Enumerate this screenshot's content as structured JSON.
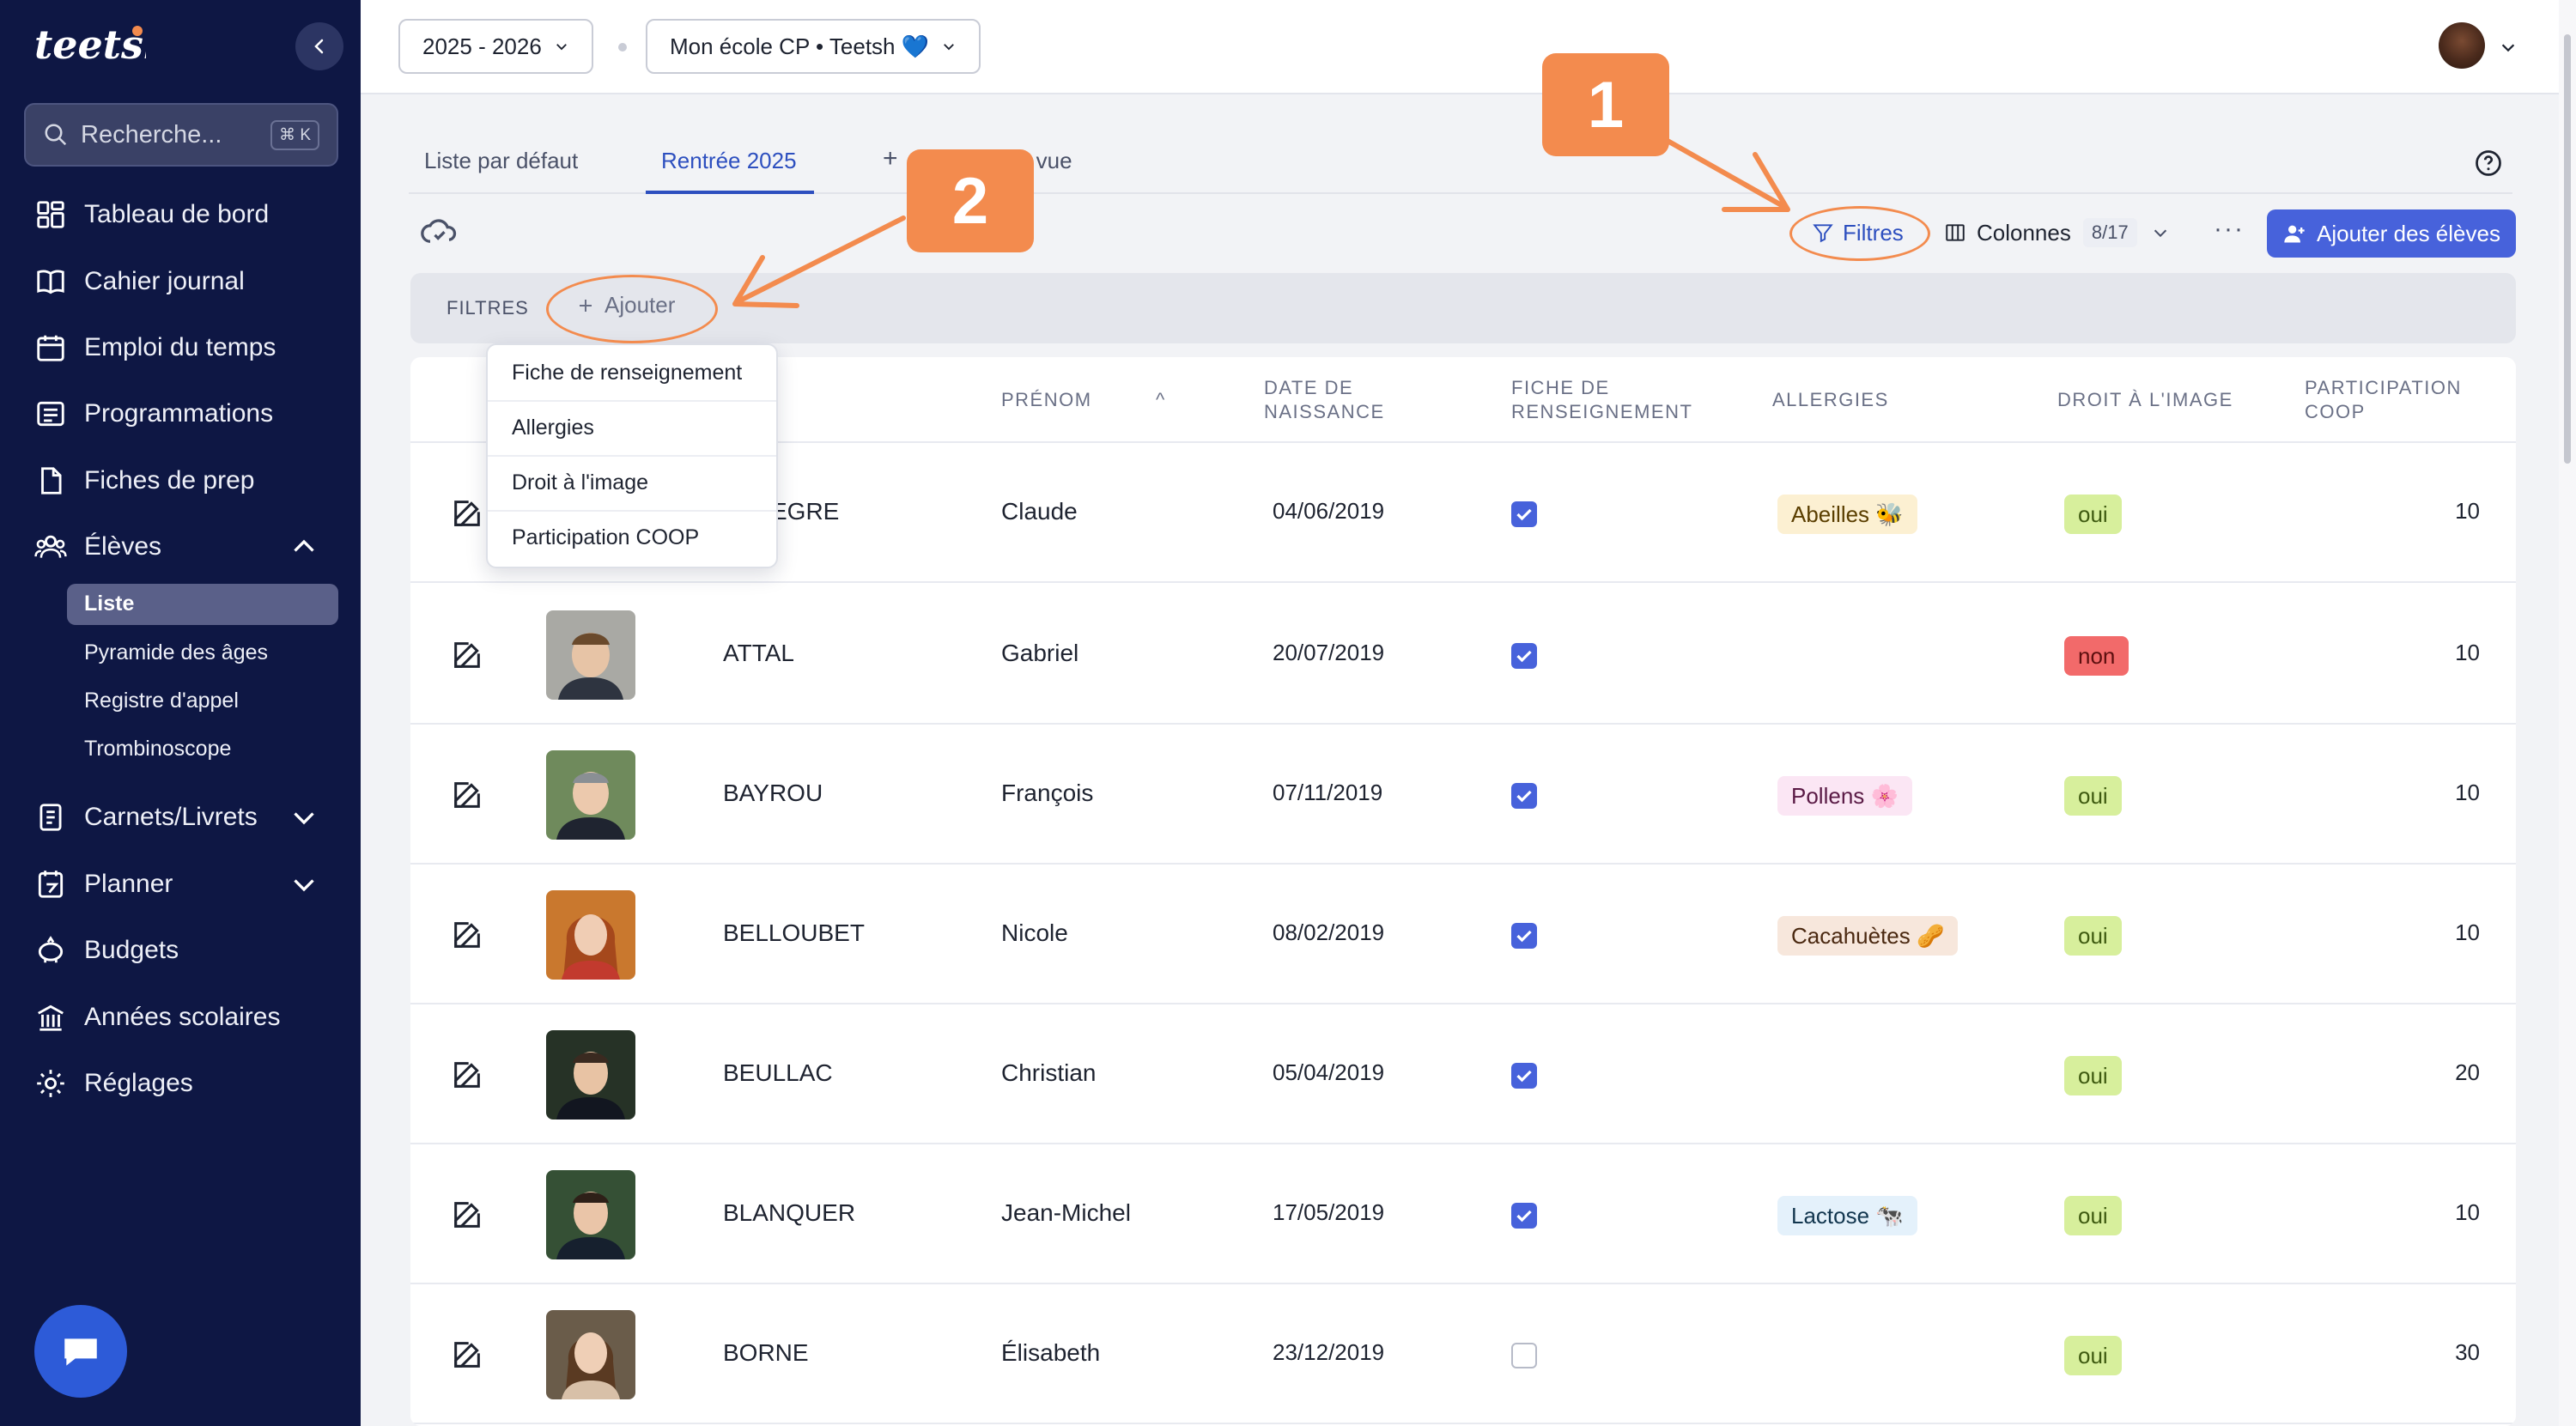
{
  "app": {
    "logo_text": "teetsh"
  },
  "sidebar": {
    "search": {
      "placeholder": "Recherche...",
      "shortcut": "⌘ K"
    },
    "items": [
      {
        "label": "Tableau de bord",
        "icon": "dashboard-icon"
      },
      {
        "label": "Cahier journal",
        "icon": "book-icon"
      },
      {
        "label": "Emploi du temps",
        "icon": "calendar-icon"
      },
      {
        "label": "Programmations",
        "icon": "list-icon"
      },
      {
        "label": "Fiches de prep",
        "icon": "document-icon"
      },
      {
        "label": "Élèves",
        "icon": "users-icon",
        "expanded": true
      },
      {
        "label": "Carnets/Livrets",
        "icon": "notebook-icon"
      },
      {
        "label": "Planner",
        "icon": "planner-icon"
      },
      {
        "label": "Budgets",
        "icon": "piggy-bank-icon"
      },
      {
        "label": "Années scolaires",
        "icon": "bank-icon"
      },
      {
        "label": "Réglages",
        "icon": "gear-icon"
      }
    ],
    "eleves_sub": [
      "Liste",
      "Pyramide des âges",
      "Registre d'appel",
      "Trombinoscope"
    ],
    "active_sub": "Liste"
  },
  "topbar": {
    "year_select": "2025 - 2026",
    "school_select": "Mon école CP • Teetsh 💙"
  },
  "tabs": {
    "items": [
      "Liste par défaut",
      "Rentrée 2025"
    ],
    "active": "Rentrée 2025",
    "add_view_prefix": "+",
    "add_view_suffix": "une vue"
  },
  "toolbar": {
    "filters_label": "Filtres",
    "columns_label": "Colonnes",
    "columns_count": "8/17",
    "more_label": "···",
    "add_students_label": "Ajouter des élèves"
  },
  "filter_bar": {
    "label": "FILTRES",
    "add_label": "Ajouter"
  },
  "filter_dropdown": {
    "options": [
      "Fiche de renseignement",
      "Allergies",
      "Droit à l'image",
      "Participation COOP"
    ]
  },
  "table": {
    "columns": {
      "prenom": "PRÉNOM",
      "date_line1": "DATE DE",
      "date_line2": "NAISSANCE",
      "fiche_line1": "FICHE DE",
      "fiche_line2": "RENSEIGNEMENT",
      "allergies": "ALLERGIES",
      "droit": "DROIT À L'IMAGE",
      "coop_line1": "PARTICIPATION",
      "coop_line2": "COOP"
    },
    "rows": [
      {
        "nom": "EGRE",
        "prenom": "Claude",
        "date": "04/06/2019",
        "fiche": true,
        "allergie": "Abeilles 🐝",
        "droit": "oui",
        "coop": "10"
      },
      {
        "nom": "ATTAL",
        "prenom": "Gabriel",
        "date": "20/07/2019",
        "fiche": true,
        "allergie": "",
        "droit": "non",
        "coop": "10"
      },
      {
        "nom": "BAYROU",
        "prenom": "François",
        "date": "07/11/2019",
        "fiche": true,
        "allergie": "Pollens 🌸",
        "droit": "oui",
        "coop": "10"
      },
      {
        "nom": "BELLOUBET",
        "prenom": "Nicole",
        "date": "08/02/2019",
        "fiche": true,
        "allergie": "Cacahuètes 🥜",
        "droit": "oui",
        "coop": "10"
      },
      {
        "nom": "BEULLAC",
        "prenom": "Christian",
        "date": "05/04/2019",
        "fiche": true,
        "allergie": "",
        "droit": "oui",
        "coop": "20"
      },
      {
        "nom": "BLANQUER",
        "prenom": "Jean-Michel",
        "date": "17/05/2019",
        "fiche": true,
        "allergie": "Lactose 🐄",
        "droit": "oui",
        "coop": "10"
      },
      {
        "nom": "BORNE",
        "prenom": "Élisabeth",
        "date": "23/12/2019",
        "fiche": false,
        "allergie": "",
        "droit": "oui",
        "coop": "30"
      }
    ]
  },
  "annotations": {
    "step1": "1",
    "step2": "2"
  },
  "colors": {
    "sidebar_bg": "#0e1744",
    "accent": "#4762db",
    "annotation": "#f38b4e",
    "oui": "#d7ef9c",
    "non": "#f26a6a"
  }
}
